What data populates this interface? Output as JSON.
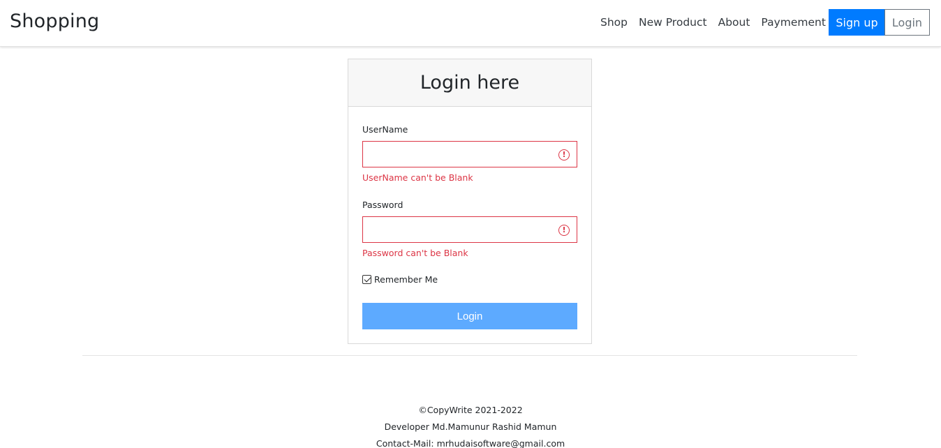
{
  "navbar": {
    "brand": "Shopping",
    "links": [
      "Shop",
      "New Product",
      "About",
      "Paymement"
    ],
    "signup_label": "Sign up",
    "login_label": "Login"
  },
  "login_card": {
    "title": "Login here",
    "username": {
      "label": "UserName",
      "value": "",
      "error": "UserName can't be Blank"
    },
    "password": {
      "label": "Password",
      "value": "",
      "error": "Password can't be Blank"
    },
    "remember_label": "Remember Me",
    "remember_checked": true,
    "submit_label": "Login"
  },
  "footer": {
    "copyright": "©CopyWrite 2021-2022",
    "developer": "Developer Md.Mamunur Rashid Mamun",
    "contact": "Contact-Mail: mrhudaisoftware@gmail.com"
  },
  "colors": {
    "primary": "#007bff",
    "submit": "#5daaff",
    "error": "#dc3545"
  }
}
